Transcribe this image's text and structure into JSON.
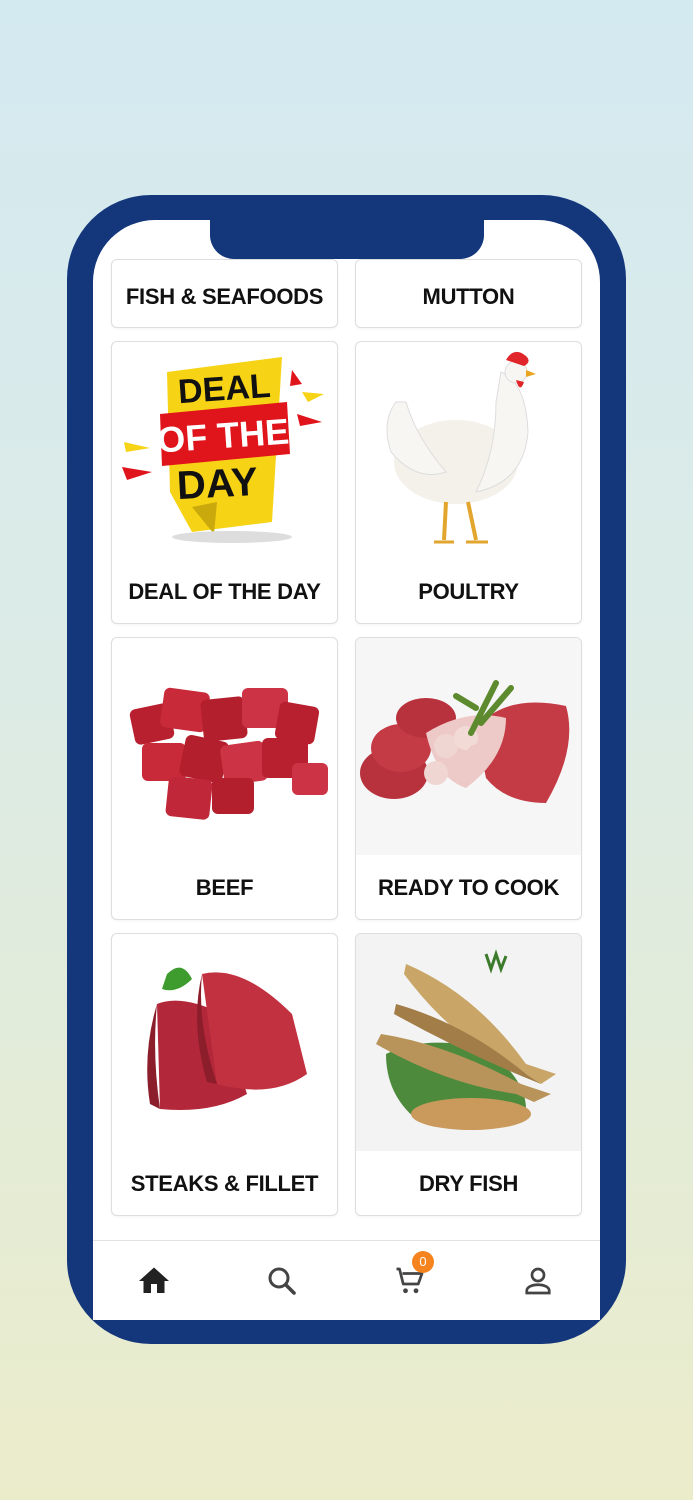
{
  "categories": [
    {
      "label": "FISH & SEAFOODS"
    },
    {
      "label": "MUTTON"
    },
    {
      "label": "DEAL OF THE DAY"
    },
    {
      "label": "POULTRY"
    },
    {
      "label": "BEEF"
    },
    {
      "label": "READY TO COOK"
    },
    {
      "label": "STEAKS & FILLET"
    },
    {
      "label": "DRY FISH"
    }
  ],
  "deal_banner": {
    "line1": "DEAL",
    "line2": "OF THE",
    "line3": "DAY"
  },
  "bottom_nav": {
    "items": [
      {
        "name": "home",
        "icon": "home-icon",
        "active": true
      },
      {
        "name": "search",
        "icon": "search-icon"
      },
      {
        "name": "cart",
        "icon": "cart-icon"
      },
      {
        "name": "profile",
        "icon": "user-icon"
      }
    ],
    "cart_count": "0"
  },
  "colors": {
    "phone_frame": "#14367b",
    "badge": "#f5841f",
    "deal_yellow": "#f7d316",
    "deal_red": "#e0141b"
  }
}
